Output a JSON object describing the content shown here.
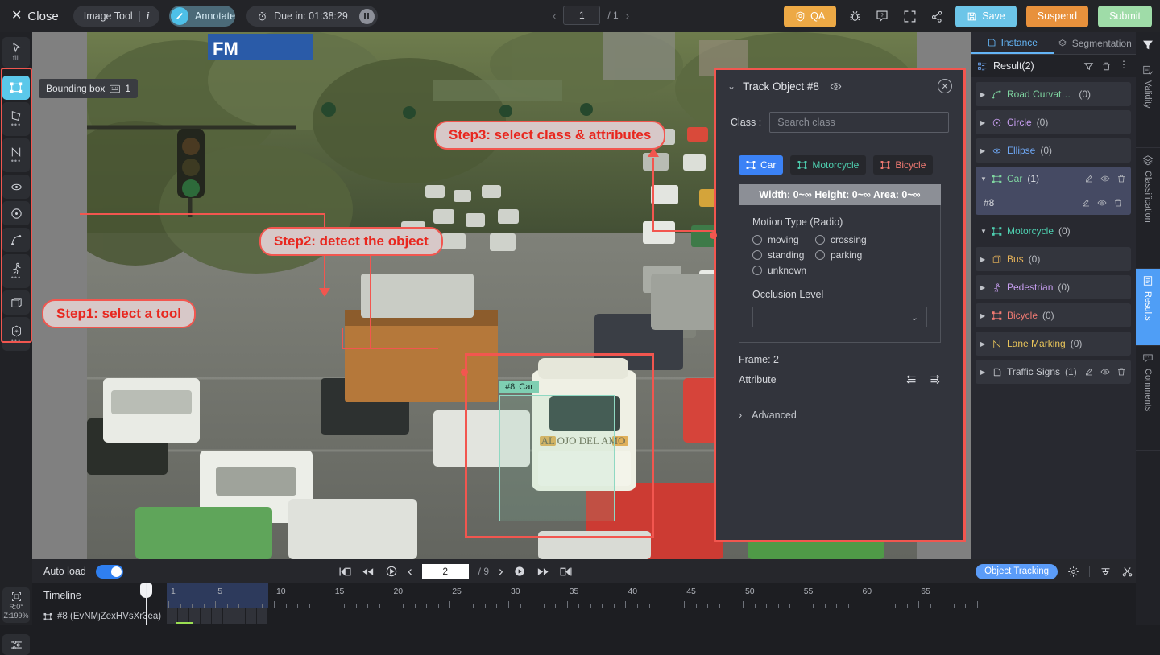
{
  "topbar": {
    "close_label": "Close",
    "image_tool_label": "Image Tool",
    "info_icon": "info-icon",
    "annotate_label": "Annotate",
    "due_label": "Due in: 01:38:29",
    "page_current": "1",
    "page_total": "/ 1",
    "qa_label": "QA",
    "save_label": "Save",
    "suspend_label": "Suspend",
    "submit_label": "Submit",
    "icons": [
      "bug-icon",
      "help-icon",
      "fullscreen-icon",
      "share-icon"
    ],
    "colors": {
      "qa": "#eda945",
      "save": "#6cc5e8",
      "suspend": "#e8913c",
      "submit": "#9fdca8",
      "accent": "#5bc8ea"
    }
  },
  "left_toolbar": {
    "pointer_label": "fill",
    "tooltip": {
      "label": "Bounding box",
      "shortcut": "1",
      "icon": "keyboard-icon"
    },
    "tools": [
      {
        "name": "bounding-box-tool",
        "icon": "rect-icon",
        "selected": true,
        "more": false
      },
      {
        "name": "polygon-tool",
        "icon": "polygon-icon",
        "selected": false,
        "more": true
      },
      {
        "name": "polyline-tool",
        "icon": "polyline-icon",
        "selected": false,
        "more": true
      },
      {
        "name": "ellipse-tool",
        "icon": "ellipse-icon",
        "selected": false,
        "more": false
      },
      {
        "name": "circle-tool",
        "icon": "circle-icon",
        "selected": false,
        "more": false
      },
      {
        "name": "curve-tool",
        "icon": "curve-icon",
        "selected": false,
        "more": false
      },
      {
        "name": "skeleton-tool",
        "icon": "skeleton-icon",
        "selected": false,
        "more": true
      },
      {
        "name": "cuboid-tool",
        "icon": "cuboid-icon",
        "selected": false,
        "more": false
      },
      {
        "name": "smart-tool",
        "icon": "magic-polygon-icon",
        "selected": false,
        "more": true
      }
    ],
    "zoom_info": {
      "rotation": "R:0°",
      "zoom": "Z:199%",
      "icon": "fit-screen-icon"
    },
    "preferences_icon": "sliders-icon"
  },
  "canvas": {
    "banner_text": "FM",
    "bbox_label_id": "#8",
    "bbox_label_class": "Car",
    "callouts": [
      {
        "name": "step1-callout",
        "text": "Step1: select a tool"
      },
      {
        "name": "step2-callout",
        "text": "Step2: detect the object"
      },
      {
        "name": "step3-callout",
        "text": "Step3: select class & attributes"
      }
    ],
    "annotation_color": "#f2564f",
    "bbox_color": "#8fd8c2"
  },
  "track_panel": {
    "title": "Track Object #8",
    "eye_icon": "eye-icon",
    "close_icon": "close-circle-icon",
    "class_label": "Class :",
    "class_placeholder": "Search class",
    "class_value": "",
    "class_buttons": [
      {
        "label": "Car",
        "active": true,
        "color": "#3b82f6"
      },
      {
        "label": "Motorcycle",
        "active": false,
        "color": "#4ecfb0"
      },
      {
        "label": "Bicycle",
        "active": false,
        "color": "#f07a73"
      }
    ],
    "size_constraints": "Width: 0~∞ Height: 0~∞ Area: 0~∞",
    "motion_type_title": "Motion Type (Radio)",
    "motion_options": [
      "moving",
      "crossing",
      "standing",
      "parking",
      "unknown"
    ],
    "occlusion_label": "Occlusion Level",
    "occlusion_value": "",
    "frame_label": "Frame: 2",
    "attribute_label": "Attribute",
    "attribute_icons": [
      "copy-left-icon",
      "copy-right-icon"
    ],
    "advanced_label": "Advanced"
  },
  "right_panel": {
    "tabs": [
      {
        "label": "Instance",
        "icon": "instance-icon",
        "active": true
      },
      {
        "label": "Segmentation",
        "icon": "segmentation-icon",
        "active": false
      }
    ],
    "result_title": "Result(2)",
    "result_icon": "list-icon",
    "header_actions": [
      "filter-icon",
      "trash-icon",
      "more-icon"
    ],
    "items": [
      {
        "label": "Road Curvat…",
        "count": "(0)",
        "color": "#7fd4a0",
        "icon": "curve-icon",
        "expanded": false,
        "selected": false,
        "actions": false
      },
      {
        "label": "Circle",
        "count": "(0)",
        "color": "#c79ef0",
        "icon": "circle-icon",
        "expanded": false,
        "selected": false,
        "actions": false
      },
      {
        "label": "Ellipse",
        "count": "(0)",
        "color": "#6fa8f5",
        "icon": "ellipse-icon",
        "expanded": false,
        "selected": false,
        "actions": false
      },
      {
        "label": "Car",
        "count": "(1)",
        "color": "#7fd4a0",
        "icon": "rect-icon",
        "expanded": true,
        "selected": true,
        "actions": true
      },
      {
        "label": "Motorcycle",
        "count": "(0)",
        "color": "#4ecfb0",
        "icon": "rect-icon",
        "expanded": true,
        "selected": false,
        "actions": false
      },
      {
        "label": "Bus",
        "count": "(0)",
        "color": "#e8b45a",
        "icon": "cuboid-icon",
        "expanded": false,
        "selected": false,
        "actions": false
      },
      {
        "label": "Pedestrian",
        "count": "(0)",
        "color": "#c79ef0",
        "icon": "skeleton-icon",
        "expanded": false,
        "selected": false,
        "actions": false
      },
      {
        "label": "Bicycle",
        "count": "(0)",
        "color": "#f07a73",
        "icon": "rect-icon",
        "expanded": false,
        "selected": false,
        "actions": false
      },
      {
        "label": "Lane Marking",
        "count": "(0)",
        "color": "#e8c45a",
        "icon": "polyline-icon",
        "expanded": false,
        "selected": false,
        "actions": false
      },
      {
        "label": "Traffic Signs",
        "count": "(1)",
        "color": "#c9ccd2",
        "icon": "polygon-icon",
        "expanded": false,
        "selected": false,
        "actions": true
      }
    ],
    "sub_item": {
      "label": "#8",
      "actions": [
        "edit-icon",
        "eye-icon",
        "trash-icon"
      ]
    },
    "vertical_tabs": [
      {
        "label": "Validity",
        "icon": "validity-icon",
        "active": false
      },
      {
        "label": "Classification",
        "icon": "classification-icon",
        "active": false
      },
      {
        "label": "Results",
        "icon": "results-icon",
        "active": true
      },
      {
        "label": "Comments",
        "icon": "comments-icon",
        "active": false
      }
    ],
    "filter_icon": "funnel-icon"
  },
  "bottom": {
    "auto_load_label": "Auto load",
    "auto_load_on": true,
    "timeline_label": "Timeline",
    "frame_current": "2",
    "frame_total": "/ 9",
    "playback_icons": [
      "first-frame-icon",
      "rewind-icon",
      "reset-icon",
      "prev-icon",
      "play-icon",
      "forward-icon",
      "last-frame-icon"
    ],
    "object_tracking_label": "Object Tracking",
    "settings_icon": "gear-icon",
    "tool_icons": [
      "merge-icon",
      "cut-icon",
      "trash-icon"
    ],
    "track_row_label": "#8 (EvNMjZexHVsXr3ea)",
    "track_row_icon": "rect-icon",
    "ruler_ticks": [
      "1",
      "5",
      "10",
      "15",
      "20",
      "25",
      "30",
      "35",
      "40",
      "45",
      "50",
      "55",
      "60",
      "65"
    ]
  }
}
